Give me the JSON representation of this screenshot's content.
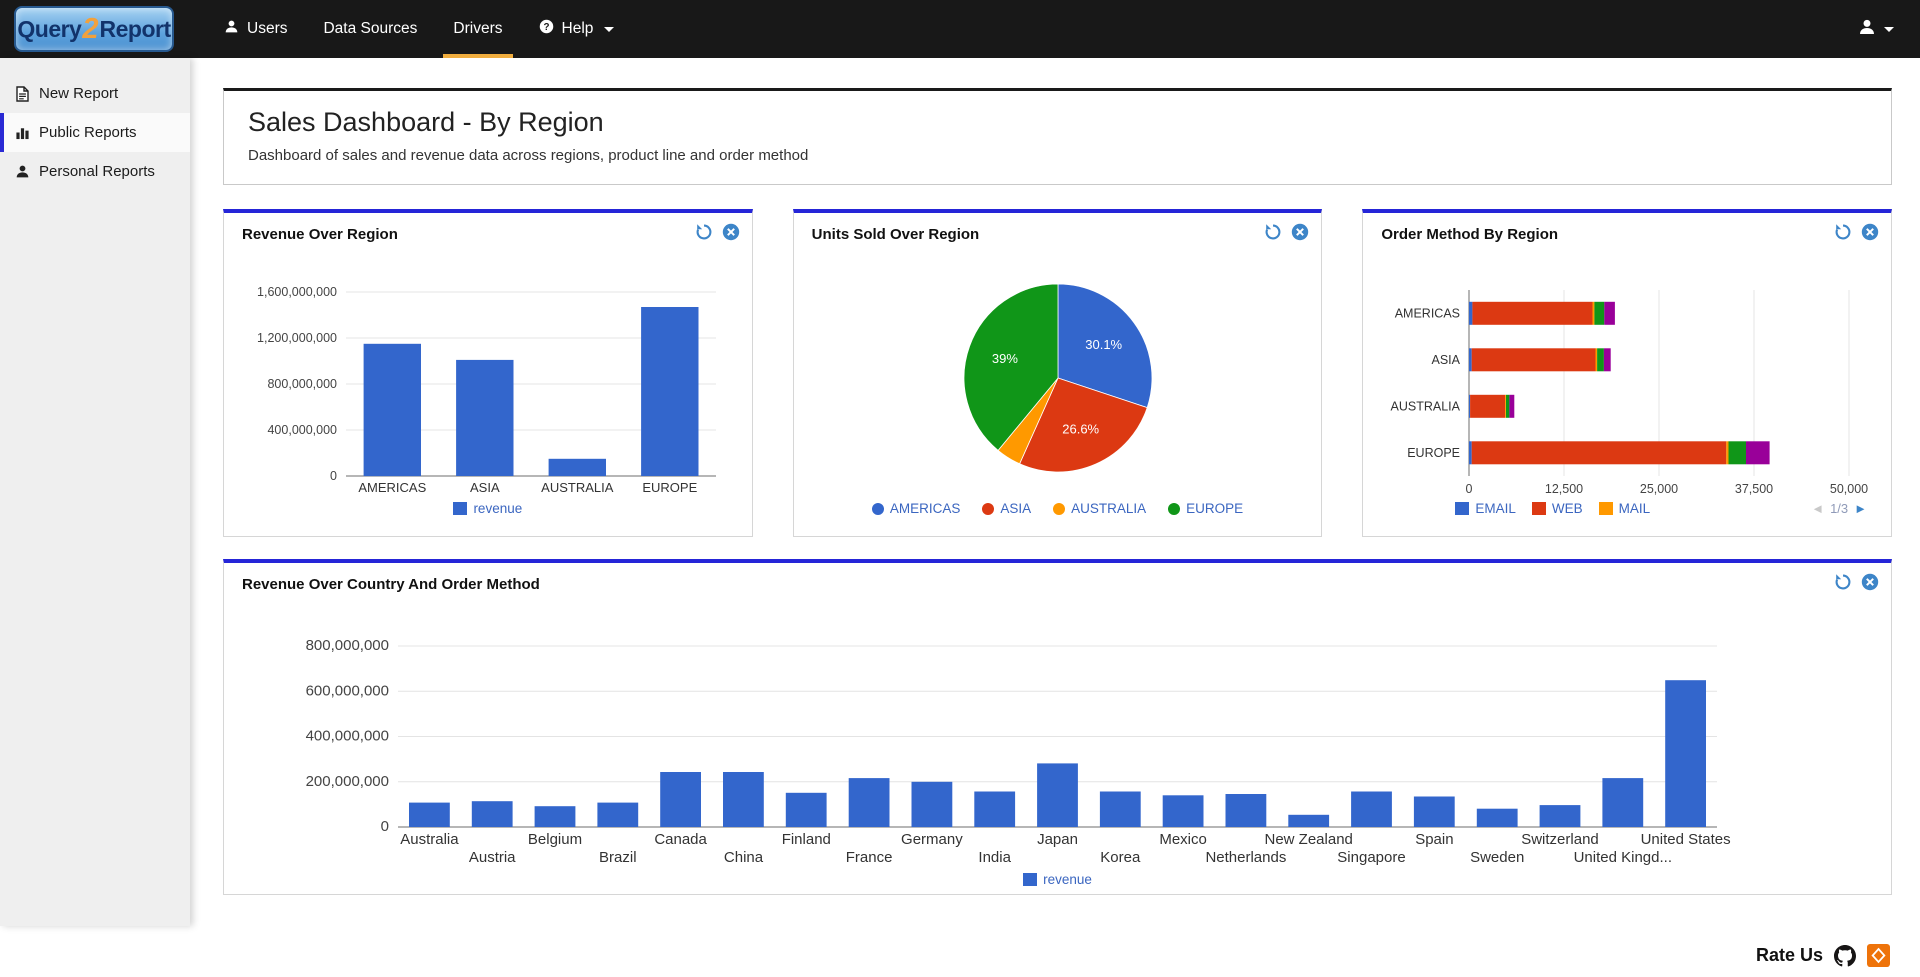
{
  "navbar": {
    "brand": {
      "part1": "Query",
      "part2": "2",
      "part3": "Report"
    },
    "items": [
      {
        "label": "Users"
      },
      {
        "label": "Data Sources"
      },
      {
        "label": "Drivers"
      },
      {
        "label": "Help"
      }
    ]
  },
  "sidebar": {
    "items": [
      {
        "label": "New Report"
      },
      {
        "label": "Public Reports"
      },
      {
        "label": "Personal Reports"
      }
    ]
  },
  "page": {
    "title": "Sales Dashboard - By Region",
    "subtitle": "Dashboard of sales and revenue data across regions, product line and order method"
  },
  "footer": {
    "rate_us_label": "Rate Us"
  },
  "chart_data": [
    {
      "id": "revenue-over-region",
      "type": "bar",
      "title": "Revenue Over Region",
      "categories": [
        "AMERICAS",
        "ASIA",
        "AUSTRALIA",
        "EUROPE"
      ],
      "values": [
        1150000000,
        1010000000,
        150000000,
        1470000000
      ],
      "ylim": [
        0,
        1600000000
      ],
      "yticks": [
        0,
        400000000,
        800000000,
        1200000000,
        1600000000
      ],
      "ytick_labels": [
        "0",
        "400,000,000",
        "800,000,000",
        "1,200,000,000",
        "1,600,000,000"
      ],
      "bar_color": "#3366cc",
      "legend": [
        {
          "label": "revenue",
          "color": "#3366cc"
        }
      ]
    },
    {
      "id": "units-sold-over-region",
      "type": "pie",
      "title": "Units Sold Over Region",
      "slices": [
        {
          "label": "AMERICAS",
          "value": 30.1,
          "display": "30.1%",
          "color": "#3366cc"
        },
        {
          "label": "ASIA",
          "value": 26.6,
          "display": "26.6%",
          "color": "#dc3912"
        },
        {
          "label": "AUSTRALIA",
          "value": 4.3,
          "display": "",
          "color": "#ff9900"
        },
        {
          "label": "EUROPE",
          "value": 39.0,
          "display": "39%",
          "color": "#109618"
        }
      ],
      "legend": [
        {
          "label": "AMERICAS",
          "color": "#3366cc"
        },
        {
          "label": "ASIA",
          "color": "#dc3912"
        },
        {
          "label": "AUSTRALIA",
          "color": "#ff9900"
        },
        {
          "label": "EUROPE",
          "color": "#109618"
        }
      ]
    },
    {
      "id": "order-method-by-region",
      "type": "stacked_bar_horizontal",
      "title": "Order Method By Region",
      "categories": [
        "AMERICAS",
        "ASIA",
        "AUSTRALIA",
        "EUROPE"
      ],
      "xlim": [
        0,
        50000
      ],
      "xticks": [
        0,
        12500,
        25000,
        37500,
        50000
      ],
      "xtick_labels": [
        "0",
        "12,500",
        "25,000",
        "37,500",
        "50,000"
      ],
      "series": [
        {
          "name": "EMAIL",
          "color": "#3366cc",
          "values": [
            450,
            350,
            150,
            350
          ]
        },
        {
          "name": "WEB",
          "color": "#dc3912",
          "values": [
            15800,
            16300,
            4600,
            33500
          ]
        },
        {
          "name": "MAIL",
          "color": "#ff9900",
          "values": [
            250,
            200,
            120,
            300
          ]
        },
        {
          "name": "",
          "color": "#109618",
          "values": [
            1300,
            900,
            450,
            2300
          ]
        },
        {
          "name": "",
          "color": "#990099",
          "values": [
            1400,
            900,
            650,
            3100
          ]
        }
      ],
      "legend": [
        {
          "label": "EMAIL",
          "color": "#3366cc"
        },
        {
          "label": "WEB",
          "color": "#dc3912"
        },
        {
          "label": "MAIL",
          "color": "#ff9900"
        }
      ],
      "pagination": {
        "current": "1/3"
      }
    },
    {
      "id": "revenue-over-country-and-order-method",
      "type": "bar",
      "title": "Revenue Over Country And Order Method",
      "categories": [
        "Australia",
        "Austria",
        "Belgium",
        "Brazil",
        "Canada",
        "China",
        "Finland",
        "France",
        "Germany",
        "India",
        "Japan",
        "Korea",
        "Mexico",
        "Netherlands",
        "New Zealand",
        "Singapore",
        "Spain",
        "Sweden",
        "Switzerland",
        "United Kingd...",
        "United States"
      ],
      "values": [
        108000000,
        114000000,
        92000000,
        108000000,
        243000000,
        243000000,
        151000000,
        216000000,
        200000000,
        157000000,
        281000000,
        157000000,
        140000000,
        146000000,
        54000000,
        157000000,
        135000000,
        81000000,
        97000000,
        216000000,
        649000000
      ],
      "ylim": [
        0,
        800000000
      ],
      "yticks": [
        0,
        200000000,
        400000000,
        600000000,
        800000000
      ],
      "ytick_labels": [
        "0",
        "200,000,000",
        "400,000,000",
        "600,000,000",
        "800,000,000"
      ],
      "bar_color": "#3366cc",
      "legend": [
        {
          "label": "revenue",
          "color": "#3366cc"
        }
      ]
    }
  ]
}
